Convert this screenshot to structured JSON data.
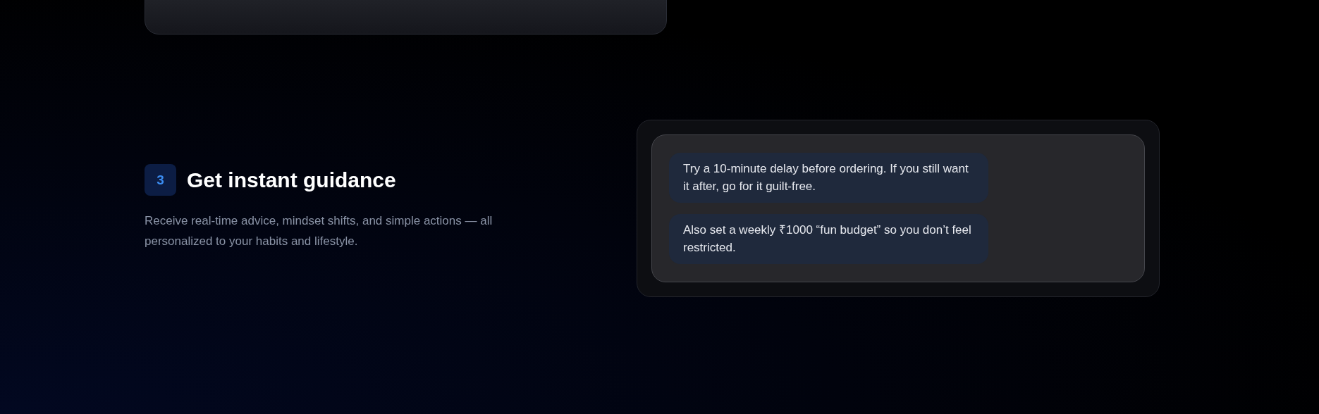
{
  "step": {
    "number": "3",
    "title": "Get instant guidance",
    "description": "Receive real-time advice, mindset shifts, and simple actions — all personalized to your habits and lifestyle."
  },
  "chat": {
    "messages": [
      {
        "text": "Try a 10-minute delay before ordering. If you still want it after, go for it guilt-free."
      },
      {
        "text": "Also set a weekly ₹1000 “fun budget” so you don’t feel restricted."
      }
    ]
  }
}
